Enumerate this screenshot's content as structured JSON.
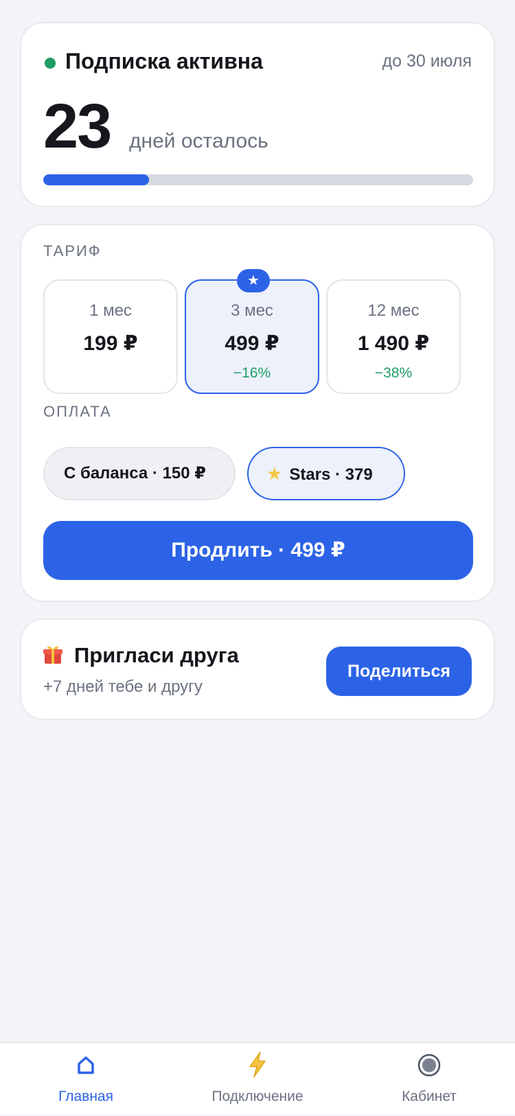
{
  "status": {
    "title": "Подписка активна",
    "until": "до 30 июля",
    "days_left": "23",
    "days_label": "дней осталось",
    "progress_fraction": 0.246,
    "status_color": "#1f9d63"
  },
  "tariff": {
    "label": "ТАРИФ",
    "plans": [
      {
        "period": "1 мес",
        "price": "199 ₽",
        "discount": "",
        "selected": false
      },
      {
        "period": "3 мес",
        "price": "499 ₽",
        "discount": "−16%",
        "selected": true,
        "badge_icon": "star-icon"
      },
      {
        "period": "12 мес",
        "price": "1 490 ₽",
        "discount": "−38%",
        "selected": false
      }
    ]
  },
  "payment": {
    "label": "ОПЛАТА",
    "balance": "С баланса · 150 ₽",
    "stars": "Stars · 379",
    "selected": "stars"
  },
  "renew_button": "Продлить · 499 ₽",
  "invite": {
    "title": "Пригласи друга",
    "subtitle": "+7 дней тебе и другу",
    "share_button": "Поделиться",
    "icon": "gift-icon"
  },
  "nav": {
    "items": [
      {
        "label": "Главная",
        "icon": "home-icon",
        "active": true
      },
      {
        "label": "Подключение",
        "icon": "lightning-icon",
        "active": false
      },
      {
        "label": "Кабинет",
        "icon": "profile-circle-icon",
        "active": false
      }
    ]
  },
  "colors": {
    "accent": "#2c63e6",
    "positive": "#1f9d63",
    "background": "#f3f4f7"
  }
}
